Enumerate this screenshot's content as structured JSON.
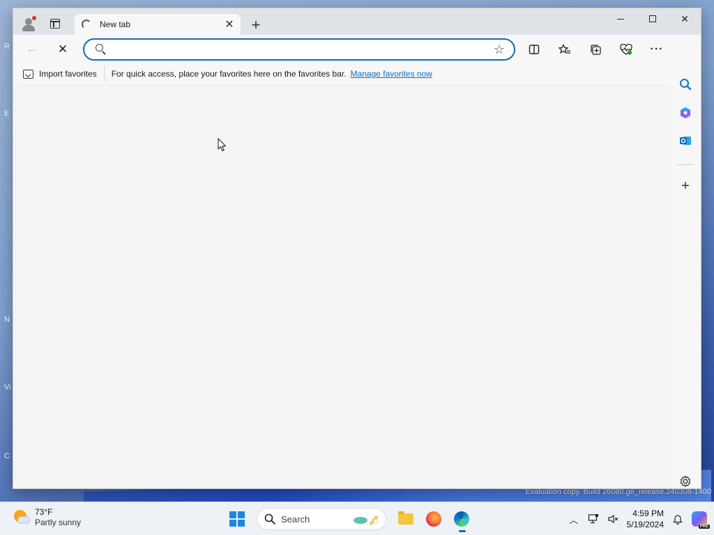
{
  "browser": {
    "tab": {
      "title": "New tab"
    },
    "favorites_bar": {
      "import_label": "Import favorites",
      "message": "For quick access, place your favorites here on the favorites bar.",
      "manage_link": "Manage favorites now"
    },
    "address_bar": {
      "value": "",
      "placeholder": ""
    },
    "accent_color": "#0f6cbd"
  },
  "desktop": {
    "evaluation_text": "Evaluation copy. Build 26080.ge_release.240308-1400",
    "left_edge_glyphs": [
      "R",
      "E",
      "N",
      "Vi",
      "C"
    ]
  },
  "taskbar": {
    "weather": {
      "temperature": "73°F",
      "condition": "Partly sunny"
    },
    "search_label": "Search",
    "clock": {
      "time": "4:59 PM",
      "date": "5/19/2024"
    }
  }
}
